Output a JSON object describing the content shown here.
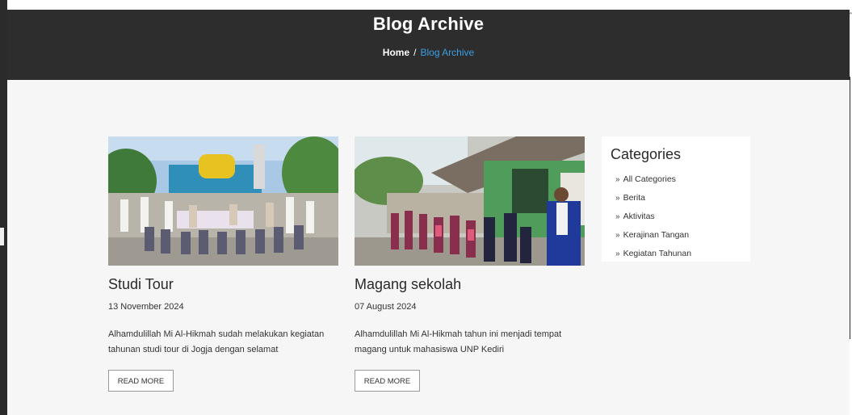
{
  "hero": {
    "title": "Blog Archive",
    "breadcrumb": {
      "home": "Home",
      "separator": "/",
      "current": "Blog Archive"
    }
  },
  "posts": [
    {
      "title": "Studi Tour",
      "date": "13 November 2024",
      "excerpt": "Alhamdulillah Mi Al-Hikmah sudah melakukan kegiatan tahunan studi tour di Jogja dengan selamat",
      "read_more": "READ MORE"
    },
    {
      "title": "Magang sekolah",
      "date": "07 August 2024",
      "excerpt": "Alhamdulillah Mi Al-Hikmah tahun ini menjadi tempat magang untuk mahasiswa UNP Kediri",
      "read_more": "READ MORE"
    }
  ],
  "sidebar": {
    "title": "Categories",
    "chevron": "»",
    "items": [
      "All Categories",
      "Berita",
      "Aktivitas",
      "Kerajinan Tangan",
      "Kegiatan Tahunan"
    ]
  },
  "colors": {
    "hero_bg": "#2d2d2d",
    "breadcrumb_active": "#3aa0e4",
    "content_bg": "#f6f6f6"
  }
}
